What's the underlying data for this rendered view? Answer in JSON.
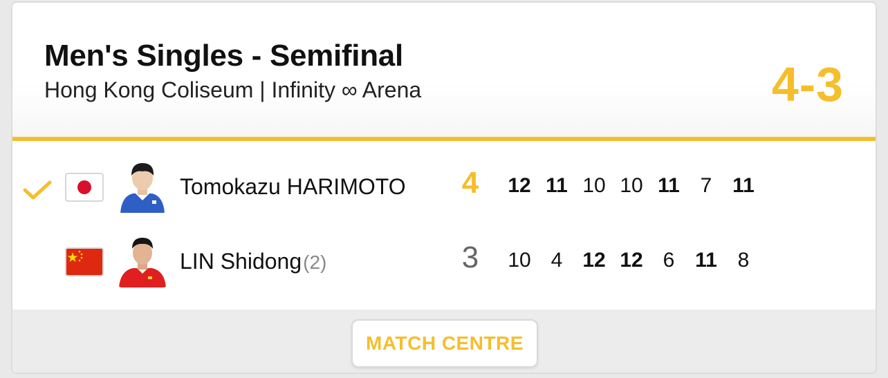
{
  "match": {
    "title": "Men's Singles - Semifinal",
    "venue": "Hong Kong Coliseum | Infinity ∞ Arena",
    "score": "4-3",
    "accent_color": "#f5be2c"
  },
  "players": [
    {
      "name": "Tomokazu HARIMOTO",
      "seed": "",
      "country_flag": "japan-flag",
      "winner": true,
      "sets_won": "4",
      "games": [
        {
          "score": "12",
          "won": true
        },
        {
          "score": "11",
          "won": true
        },
        {
          "score": "10",
          "won": false
        },
        {
          "score": "10",
          "won": false
        },
        {
          "score": "11",
          "won": true
        },
        {
          "score": "7",
          "won": false
        },
        {
          "score": "11",
          "won": true
        }
      ]
    },
    {
      "name": "LIN Shidong",
      "seed": "(2)",
      "country_flag": "china-flag",
      "winner": false,
      "sets_won": "3",
      "games": [
        {
          "score": "10",
          "won": false
        },
        {
          "score": "4",
          "won": false
        },
        {
          "score": "12",
          "won": true
        },
        {
          "score": "12",
          "won": true
        },
        {
          "score": "6",
          "won": false
        },
        {
          "score": "11",
          "won": true
        },
        {
          "score": "8",
          "won": false
        }
      ]
    }
  ],
  "footer": {
    "button_label": "MATCH CENTRE"
  }
}
